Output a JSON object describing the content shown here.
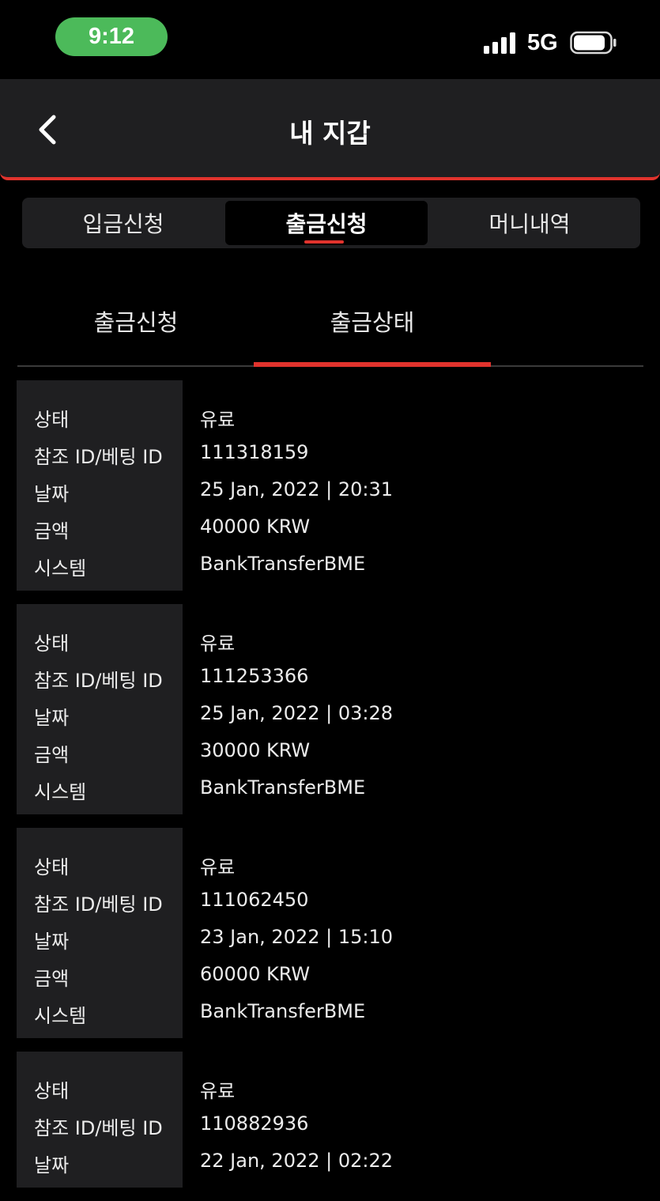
{
  "status_bar": {
    "time": "9:12",
    "network": "5G"
  },
  "header": {
    "title": "내 지갑"
  },
  "main_tabs": [
    {
      "label": "입금신청"
    },
    {
      "label": "출금신청"
    },
    {
      "label": "머니내역"
    }
  ],
  "sub_tabs": [
    {
      "label": "출금신청"
    },
    {
      "label": "출금상태"
    }
  ],
  "field_labels": {
    "status": "상태",
    "ref_id": "참조 ID/베팅 ID",
    "date": "날짜",
    "amount": "금액",
    "system": "시스템"
  },
  "records": [
    {
      "status": "유료",
      "ref_id": "111318159",
      "date": "25 Jan, 2022 | 20:31",
      "amount": "40000 KRW",
      "system": "BankTransferBME"
    },
    {
      "status": "유료",
      "ref_id": "111253366",
      "date": "25 Jan, 2022 | 03:28",
      "amount": "30000 KRW",
      "system": "BankTransferBME"
    },
    {
      "status": "유료",
      "ref_id": "111062450",
      "date": "23 Jan, 2022 | 15:10",
      "amount": "60000 KRW",
      "system": "BankTransferBME"
    },
    {
      "status": "유료",
      "ref_id": "110882936",
      "date": "22 Jan, 2022 | 02:22"
    }
  ],
  "colors": {
    "accent": "#e1332d",
    "panel": "#1f1f21",
    "time_pill": "#4cba5a"
  }
}
